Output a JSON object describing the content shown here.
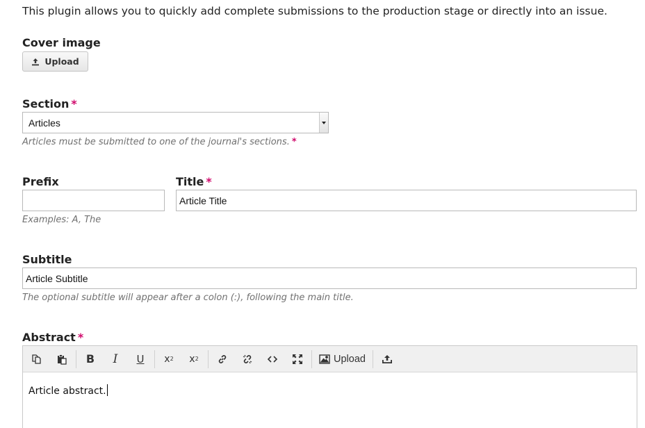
{
  "intro": "This plugin allows you to quickly add complete submissions to the production stage or directly into an issue.",
  "cover_image": {
    "label": "Cover image",
    "upload_button": "Upload"
  },
  "section": {
    "label": "Section",
    "required_marker": "*",
    "selected_value": "Articles",
    "hint": "Articles must be submitted to one of the journal's sections.",
    "hint_required_marker": "*"
  },
  "prefix": {
    "label": "Prefix",
    "value": "",
    "hint": "Examples: A, The"
  },
  "title": {
    "label": "Title",
    "required_marker": "*",
    "value": "Article Title"
  },
  "subtitle": {
    "label": "Subtitle",
    "value": "Article Subtitle",
    "hint": "The optional subtitle will appear after a colon (:), following the main title."
  },
  "abstract": {
    "label": "Abstract",
    "required_marker": "*",
    "toolbar": {
      "items": [
        "copy-icon",
        "paste-icon",
        "bold-icon",
        "italic-icon",
        "underline-icon",
        "superscript-icon",
        "subscript-icon",
        "link-icon",
        "unlink-icon",
        "code-icon",
        "fullscreen-icon",
        "image-icon",
        "upload-icon"
      ],
      "upload_label": "Upload"
    },
    "content": "Article abstract."
  },
  "colors": {
    "required": "#d00a6c",
    "hint_text": "#707070",
    "toolbar_bg": "#f0f0f0"
  }
}
